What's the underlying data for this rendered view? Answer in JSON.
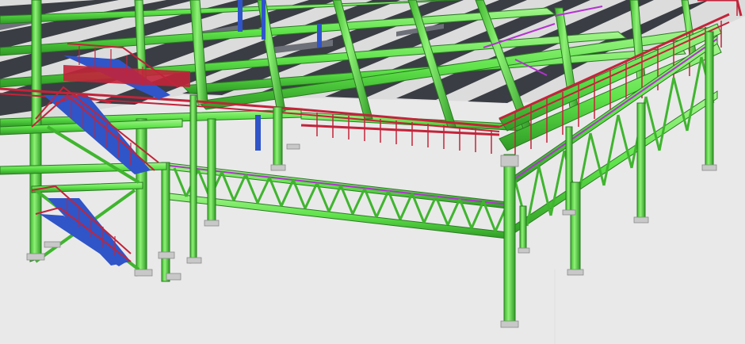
{
  "scene": {
    "description_label": "",
    "colors": {
      "background": "#e9e9e9",
      "steel_primary": "#5fe34a",
      "steel_shadow": "#2f9a25",
      "steel_highlight": "#a6f58f",
      "handrail": "#c2243a",
      "stair_stringer": "#2f55c9",
      "bracing": "#b333d0",
      "deck_dark": "#3a3d44",
      "deck_light": "#6d7078",
      "footing": "#c8c8c8"
    },
    "icons": {
      "model": "steel-structure-icon"
    }
  }
}
